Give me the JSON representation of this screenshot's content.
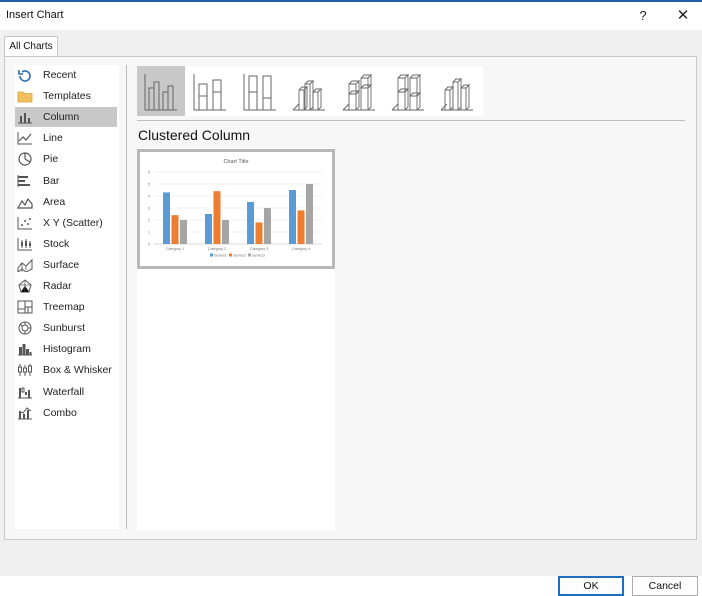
{
  "window": {
    "title": "Insert Chart",
    "help_label": "?",
    "close_label": "✕"
  },
  "tabs": [
    {
      "label": "All Charts"
    }
  ],
  "chart_types": [
    {
      "label": "Recent",
      "icon": "recent-icon"
    },
    {
      "label": "Templates",
      "icon": "folder-icon"
    },
    {
      "label": "Column",
      "icon": "column-chart-icon",
      "selected": true
    },
    {
      "label": "Line",
      "icon": "line-chart-icon"
    },
    {
      "label": "Pie",
      "icon": "pie-chart-icon"
    },
    {
      "label": "Bar",
      "icon": "bar-chart-icon"
    },
    {
      "label": "Area",
      "icon": "area-chart-icon"
    },
    {
      "label": "X Y (Scatter)",
      "icon": "scatter-chart-icon"
    },
    {
      "label": "Stock",
      "icon": "stock-chart-icon"
    },
    {
      "label": "Surface",
      "icon": "surface-chart-icon"
    },
    {
      "label": "Radar",
      "icon": "radar-chart-icon"
    },
    {
      "label": "Treemap",
      "icon": "treemap-chart-icon"
    },
    {
      "label": "Sunburst",
      "icon": "sunburst-chart-icon"
    },
    {
      "label": "Histogram",
      "icon": "histogram-chart-icon"
    },
    {
      "label": "Box & Whisker",
      "icon": "box-whisker-chart-icon"
    },
    {
      "label": "Waterfall",
      "icon": "waterfall-chart-icon"
    },
    {
      "label": "Combo",
      "icon": "combo-chart-icon"
    }
  ],
  "subtypes": [
    {
      "icon": "clustered-column-icon",
      "selected": true
    },
    {
      "icon": "stacked-column-icon"
    },
    {
      "icon": "100-stacked-column-icon"
    },
    {
      "icon": "3d-clustered-column-icon"
    },
    {
      "icon": "3d-stacked-column-icon"
    },
    {
      "icon": "3d-100-stacked-column-icon"
    },
    {
      "icon": "3d-column-icon"
    }
  ],
  "selected_subtype_name": "Clustered Column",
  "preview": {
    "chart_data": {
      "type": "bar",
      "title": "Chart Title",
      "categories": [
        "Category 1",
        "Category 2",
        "Category 3",
        "Category 4"
      ],
      "series": [
        {
          "name": "Series1",
          "values": [
            4.3,
            2.5,
            3.5,
            4.5
          ],
          "color": "#5b9bd5"
        },
        {
          "name": "Series2",
          "values": [
            2.4,
            4.4,
            1.8,
            2.8
          ],
          "color": "#ed7d31"
        },
        {
          "name": "Series3",
          "values": [
            2.0,
            2.0,
            3.0,
            5.0
          ],
          "color": "#a5a5a5"
        }
      ],
      "yticks": [
        "0",
        "1",
        "2",
        "3",
        "4",
        "5",
        "6"
      ],
      "ylim": [
        0,
        6
      ],
      "grid": true,
      "legend": "bottom"
    }
  },
  "buttons": {
    "ok_label": "OK",
    "cancel_label": "Cancel"
  },
  "colors": {
    "selection": "#c8c8c8",
    "accent": "#1f6fc0",
    "title_bar_line": "#1f5fa8"
  }
}
